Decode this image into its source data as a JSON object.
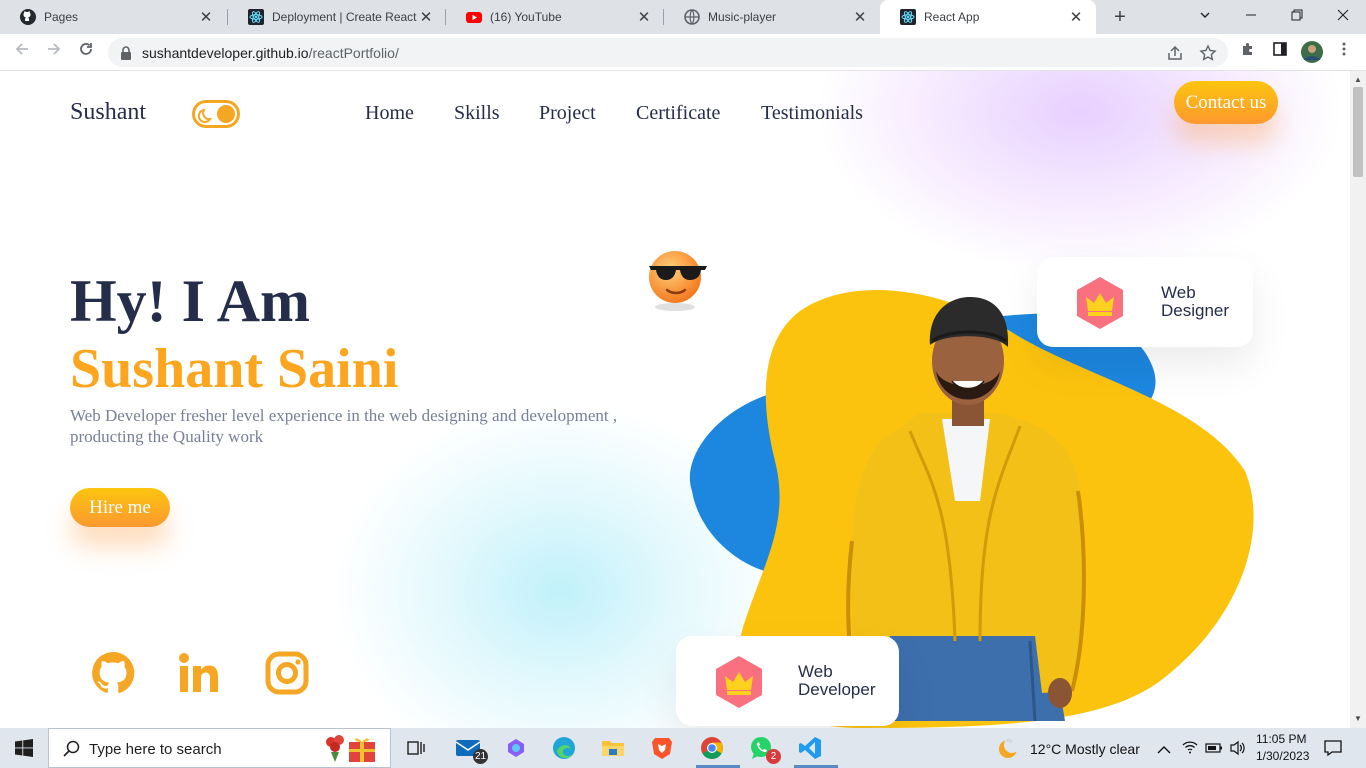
{
  "browser": {
    "tabs": [
      {
        "title": "Pages",
        "icon": "github-icon"
      },
      {
        "title": "Deployment | Create React App",
        "icon": "react-icon"
      },
      {
        "title": "(16) YouTube",
        "icon": "youtube-icon"
      },
      {
        "title": "Music-player",
        "icon": "globe-icon"
      },
      {
        "title": "React App",
        "icon": "react-icon",
        "active": true
      }
    ],
    "close_glyph": "✕",
    "url_host": "sushantdeveloper.github.io",
    "url_path": "/reactPortfolio/"
  },
  "site": {
    "logo": "Sushant",
    "nav": [
      "Home",
      "Skills",
      "Project",
      "Certificate",
      "Testimonials"
    ],
    "contact_button": "Contact us",
    "hero": {
      "greeting": "Hy! I Am",
      "name": "Sushant Saini",
      "description": "Web Developer fresher level experience in the web designing and development , producting the Quality work",
      "hire_button": "Hire me"
    },
    "cards": [
      {
        "line1": "Web",
        "line2": "Designer"
      },
      {
        "line1": "Web",
        "line2": "Developer"
      }
    ],
    "social": [
      "github-icon",
      "linkedin-icon",
      "instagram-icon"
    ],
    "colors": {
      "accent": "#fca61f",
      "dark": "#242d49",
      "blob_yellow": "#fcc30e",
      "blob_blue": "#1d87e0"
    }
  },
  "taskbar": {
    "search_placeholder": "Type here to search",
    "mail_badge": "21",
    "whatsapp_badge": "2",
    "weather": "12°C  Mostly clear",
    "time": "11:05 PM",
    "date": "1/30/2023"
  }
}
